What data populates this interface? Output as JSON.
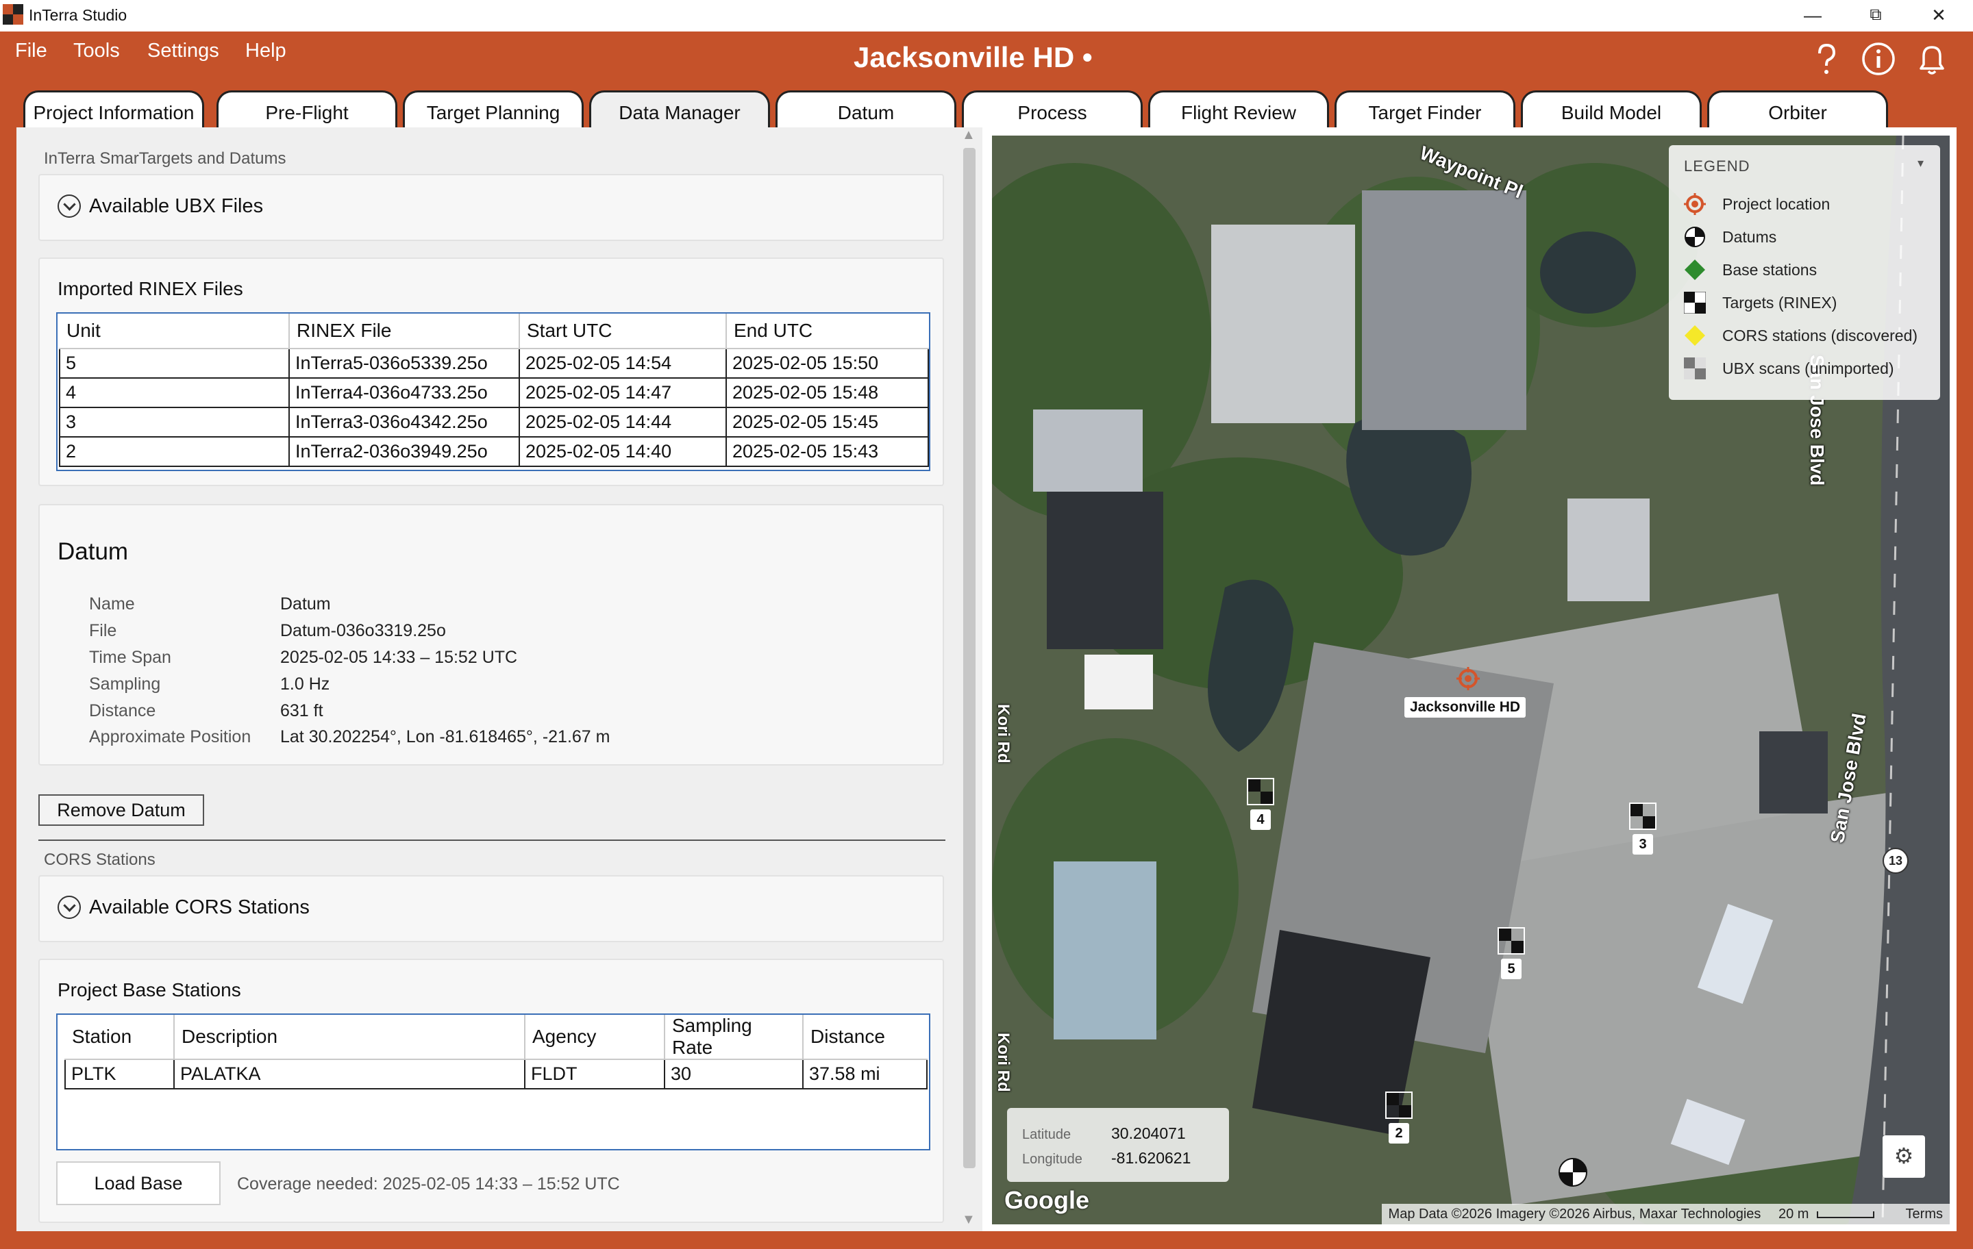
{
  "app": {
    "title": "InTerra Studio",
    "project_title": "Jacksonville HD •"
  },
  "window_controls": {
    "minimize": "—",
    "restore": "⧉",
    "close": "✕"
  },
  "menu": [
    "File",
    "Tools",
    "Settings",
    "Help"
  ],
  "header_icons": [
    "help-icon",
    "info-icon",
    "bell-icon"
  ],
  "tabs": [
    "Project Information",
    "Pre-Flight",
    "Target Planning",
    "Data Manager",
    "Datum",
    "Process",
    "Flight Review",
    "Target Finder",
    "Build Model",
    "Orbiter"
  ],
  "active_tab": "Data Manager",
  "colors": {
    "brand": "#C5522A",
    "selection_border": "#3A6FB7"
  },
  "left": {
    "smartargets_section": "InTerra SmarTargets and Datums",
    "ubx_expander": "Available UBX Files",
    "rinex": {
      "title": "Imported RINEX Files",
      "columns": [
        "Unit",
        "RINEX File",
        "Start UTC",
        "End UTC"
      ],
      "rows": [
        [
          "5",
          "InTerra5-036o5339.25o",
          "2025-02-05 14:54",
          "2025-02-05 15:50"
        ],
        [
          "4",
          "InTerra4-036o4733.25o",
          "2025-02-05 14:47",
          "2025-02-05 15:48"
        ],
        [
          "3",
          "InTerra3-036o4342.25o",
          "2025-02-05 14:44",
          "2025-02-05 15:45"
        ],
        [
          "2",
          "InTerra2-036o3949.25o",
          "2025-02-05 14:40",
          "2025-02-05 15:43"
        ]
      ]
    },
    "datum": {
      "title": "Datum",
      "fields": [
        {
          "key": "Name",
          "value": "Datum"
        },
        {
          "key": "File",
          "value": "Datum-036o3319.25o"
        },
        {
          "key": "Time Span",
          "value": "2025-02-05 14:33 – 15:52 UTC"
        },
        {
          "key": "Sampling",
          "value": "1.0 Hz"
        },
        {
          "key": "Distance",
          "value": "631 ft"
        },
        {
          "key": "Approximate Position",
          "value": "Lat 30.202254°, Lon -81.618465°, -21.67 m"
        }
      ],
      "remove_button": "Remove Datum"
    },
    "cors_section": "CORS Stations",
    "cors_expander": "Available CORS Stations",
    "base": {
      "title": "Project Base Stations",
      "columns": [
        "Station",
        "Description",
        "Agency",
        "Sampling Rate",
        "Distance"
      ],
      "rows": [
        [
          "PLTK",
          "PALATKA",
          "FLDT",
          "30",
          "37.58 mi"
        ]
      ],
      "load_button": "Load Base",
      "coverage": "Coverage needed: 2025-02-05 14:33 – 15:52 UTC"
    }
  },
  "map": {
    "legend": {
      "title": "LEGEND",
      "items": [
        {
          "label": "Project location",
          "icon": "project-location-icon"
        },
        {
          "label": "Datums",
          "icon": "datum-icon"
        },
        {
          "label": "Base stations",
          "icon": "base-station-icon"
        },
        {
          "label": "Targets (RINEX)",
          "icon": "target-icon"
        },
        {
          "label": "CORS stations (discovered)",
          "icon": "cors-icon"
        },
        {
          "label": "UBX scans (unimported)",
          "icon": "ubx-icon"
        }
      ]
    },
    "project_label": "Jacksonville HD",
    "targets": [
      "4",
      "3",
      "5",
      "2"
    ],
    "roads": [
      "Waypoint Pl",
      "San Jose Blvd",
      "San Jose Blvd",
      "Kori Rd",
      "Kori Rd"
    ],
    "route_shield": "13",
    "coords": {
      "lat_label": "Latitude",
      "lat": "30.204071",
      "lon_label": "Longitude",
      "lon": "-81.620621"
    },
    "google": "Google",
    "attribution": "Map Data ©2026 Imagery ©2026 Airbus, Maxar Technologies",
    "scale": "20 m",
    "terms": "Terms"
  }
}
